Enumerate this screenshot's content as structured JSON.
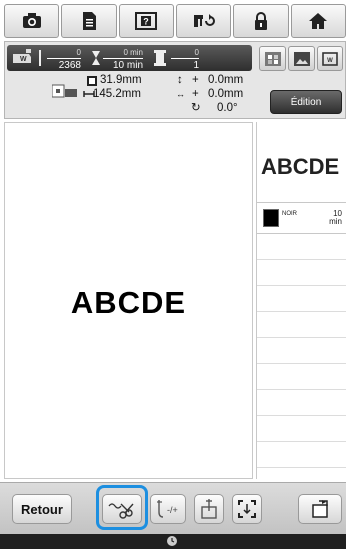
{
  "toolbar": {
    "icons": [
      "camera-icon",
      "document-icon",
      "help-icon",
      "machine-sewing-icon",
      "lock-icon",
      "home-icon"
    ]
  },
  "stats": {
    "stitch_current": "0",
    "stitch_total": "2368",
    "time_current": "0 min",
    "time_total": "10 min",
    "color_current": "0",
    "color_total": "1"
  },
  "dimensions": {
    "height": "31.9mm",
    "width": "145.2mm",
    "offset_vertical": "0.0mm",
    "offset_horizontal": "0.0mm",
    "rotation": "0.0°"
  },
  "edition_button": "Édition",
  "preview": {
    "text": "ABCDE"
  },
  "side_panel": {
    "thumbnail_text": "ABCDE",
    "color_name": "NOIR",
    "color_time_value": "10",
    "color_time_unit": "min"
  },
  "bottom": {
    "retour_label": "Retour"
  },
  "colors": {
    "highlight": "#1d8fe0",
    "accent_dark": "#2f2f2f"
  }
}
